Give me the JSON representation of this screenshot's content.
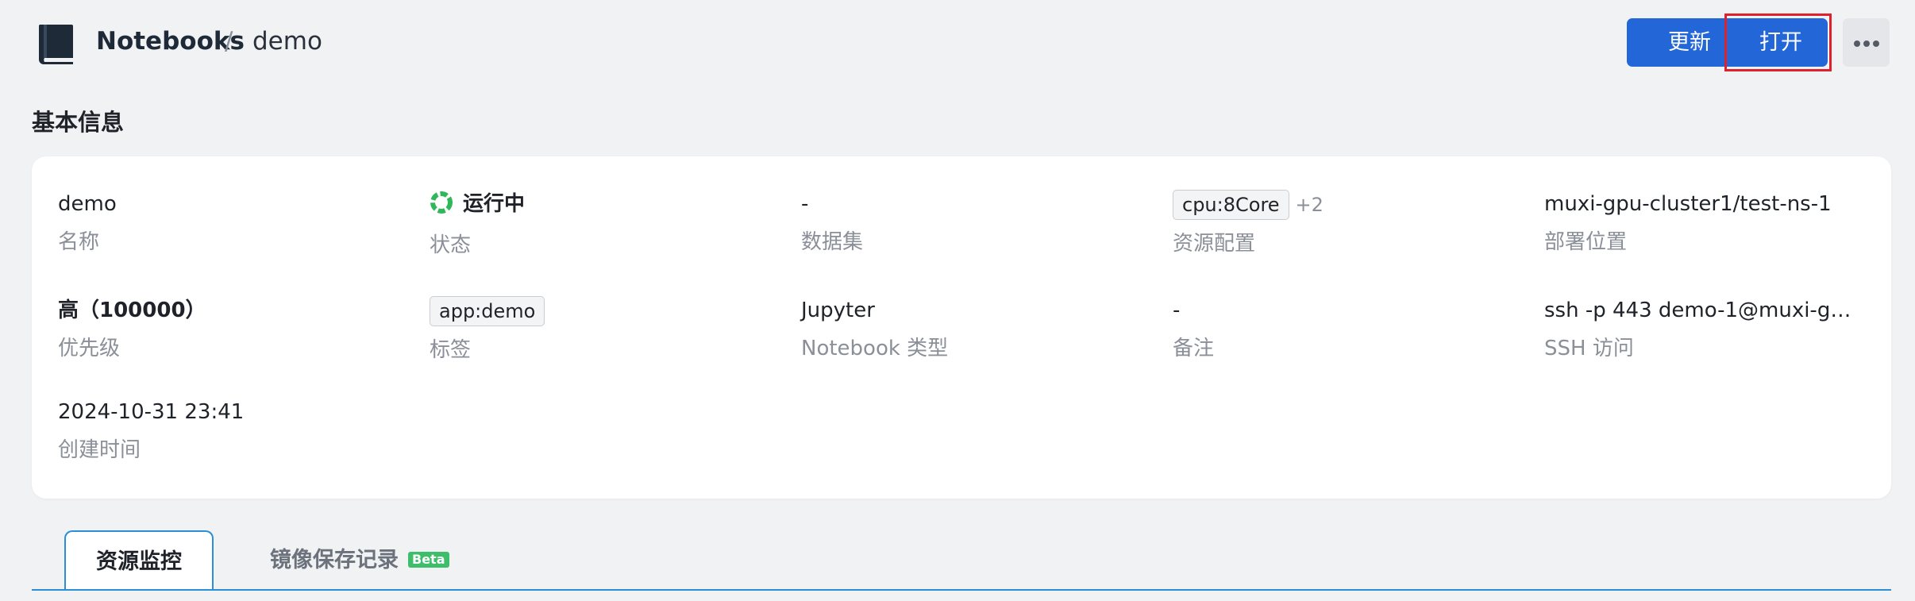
{
  "header": {
    "breadcrumb_root": "Notebooks",
    "breadcrumb_separator": "/",
    "breadcrumb_current": "demo",
    "icon": "notebook-icon",
    "actions": {
      "update_label": "更新",
      "open_label": "打开",
      "more_icon": "more-horizontal-icon"
    },
    "accent_color": "#2366d8",
    "highlight_color": "#e0202a"
  },
  "basic_info": {
    "section_title": "基本信息",
    "fields": {
      "name": {
        "value": "demo",
        "label": "名称"
      },
      "status": {
        "value": "运行中",
        "label": "状态",
        "icon": "running-status-icon",
        "color": "#2fb85a"
      },
      "dataset": {
        "value": "-",
        "label": "数据集"
      },
      "resources": {
        "tag": "cpu:8Core",
        "extra": "+2",
        "label": "资源配置"
      },
      "location": {
        "value": "muxi-gpu-cluster1/test-ns-1",
        "label": "部署位置"
      },
      "priority": {
        "value": "高（100000）",
        "label": "优先级"
      },
      "tags": {
        "tag": "app:demo",
        "label": "标签"
      },
      "notebook_type": {
        "value": "Jupyter",
        "label": "Notebook 类型"
      },
      "remark": {
        "value": "-",
        "label": "备注"
      },
      "ssh": {
        "value": "ssh -p 443 demo-1@muxi-gpu-...",
        "label": "SSH 访问"
      },
      "created": {
        "value": "2024-10-31 23:41",
        "label": "创建时间"
      }
    }
  },
  "tabs": {
    "items": [
      {
        "label": "资源监控",
        "active": true
      },
      {
        "label": "镜像保存记录",
        "badge": "Beta",
        "active": false
      }
    ]
  }
}
